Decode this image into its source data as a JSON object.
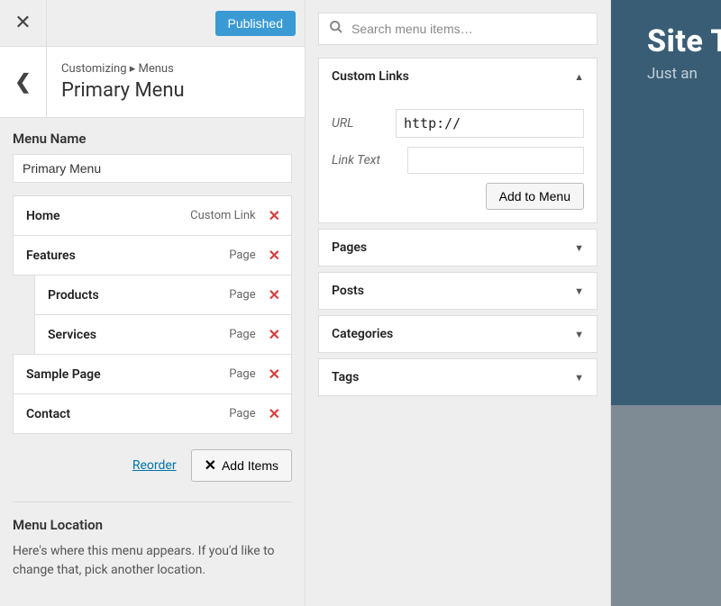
{
  "topbar": {
    "published": "Published"
  },
  "header": {
    "breadcrumb": "Customizing ▸ Menus",
    "title": "Primary Menu"
  },
  "menuName": {
    "label": "Menu Name",
    "value": "Primary Menu"
  },
  "menuItems": [
    {
      "title": "Home",
      "type": "Custom Link",
      "indent": false
    },
    {
      "title": "Features",
      "type": "Page",
      "indent": false
    },
    {
      "title": "Products",
      "type": "Page",
      "indent": true
    },
    {
      "title": "Services",
      "type": "Page",
      "indent": true
    },
    {
      "title": "Sample Page",
      "type": "Page",
      "indent": false
    },
    {
      "title": "Contact",
      "type": "Page",
      "indent": false
    }
  ],
  "actions": {
    "reorder": "Reorder",
    "addItems": "Add Items"
  },
  "menuLocation": {
    "heading": "Menu Location",
    "help": "Here's where this menu appears. If you'd like to change that, pick another location."
  },
  "search": {
    "placeholder": "Search menu items…"
  },
  "customLinks": {
    "heading": "Custom Links",
    "urlLabel": "URL",
    "urlValue": "http://",
    "textLabel": "Link Text",
    "textValue": "",
    "addBtn": "Add to Menu"
  },
  "accordions": [
    {
      "label": "Pages"
    },
    {
      "label": "Posts"
    },
    {
      "label": "Categories"
    },
    {
      "label": "Tags"
    }
  ],
  "preview": {
    "siteTitle": "Site T",
    "tagline": "Just an"
  }
}
